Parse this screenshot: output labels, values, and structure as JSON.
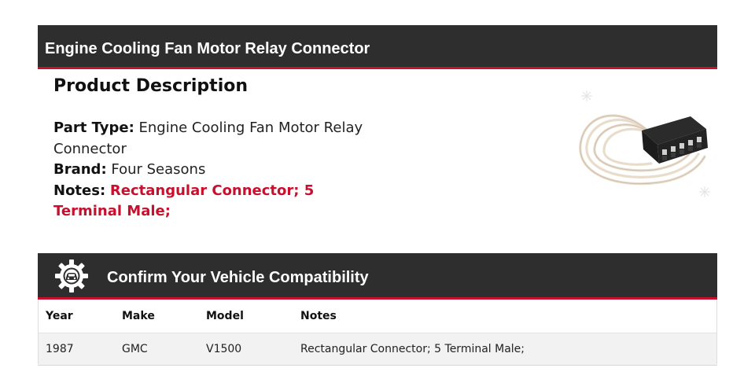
{
  "header": {
    "title": "Engine Cooling Fan Motor Relay Connector"
  },
  "description": {
    "heading": "Product Description",
    "part_type_label": "Part Type:",
    "part_type_value": "Engine Cooling Fan Motor Relay Connector",
    "brand_label": "Brand:",
    "brand_value": "Four Seasons",
    "notes_label": "Notes:",
    "notes_value": "Rectangular Connector; 5 Terminal Male;"
  },
  "compatibility": {
    "title": "Confirm Your Vehicle Compatibility",
    "icon": "gear-car-icon",
    "columns": [
      "Year",
      "Make",
      "Model",
      "Notes"
    ],
    "rows": [
      [
        "1987",
        "GMC",
        "V1500",
        "Rectangular Connector; 5 Terminal Male;"
      ]
    ]
  },
  "colors": {
    "bar_background": "#2e2e2e",
    "accent_red": "#c8102e"
  }
}
